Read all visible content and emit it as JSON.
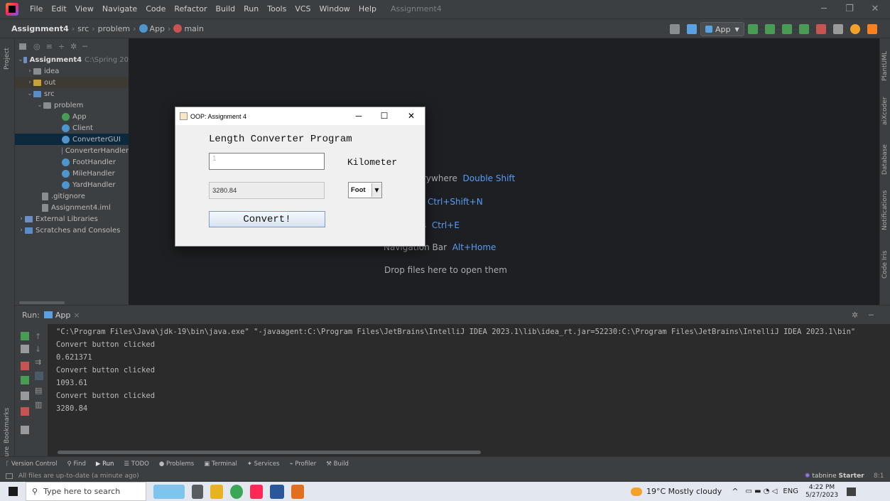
{
  "menubar": {
    "items": [
      "File",
      "Edit",
      "View",
      "Navigate",
      "Code",
      "Refactor",
      "Build",
      "Run",
      "Tools",
      "VCS",
      "Window",
      "Help"
    ],
    "project_title": "Assignment4"
  },
  "breadcrumb": {
    "project": "Assignment4",
    "items": [
      "src",
      "problem",
      "App",
      "main"
    ]
  },
  "toolbar": {
    "run_config": "App"
  },
  "left_strip": {
    "project": "Project",
    "bookmarks": "Bookmarks",
    "structure": "Structure"
  },
  "right_strip": {
    "items": [
      "PlantUML",
      "aiXcoder",
      "Database",
      "Notifications",
      "Code Iris"
    ]
  },
  "project_tree": {
    "root": "Assignment4",
    "root_path": "C:\\Spring 20",
    "items": [
      "idea",
      "out",
      "src",
      "problem",
      "App",
      "Client",
      "ConverterGUI",
      "ConverterHandler",
      "FootHandler",
      "MileHandler",
      "YardHandler",
      ".gitignore",
      "Assignment4.iml",
      "External Libraries",
      "Scratches and Consoles"
    ]
  },
  "editor_hints": {
    "search_everywhere": "rywhere",
    "search_everywhere_key": "Double Shift",
    "goto_file_key": "Ctrl+Shift+N",
    "recent_files": "s",
    "recent_files_key": "Ctrl+E",
    "nav_bar": "Navigation Bar",
    "nav_bar_key": "Alt+Home",
    "drop": "Drop files here to open them"
  },
  "dialog": {
    "title": "OOP: Assignment 4",
    "heading": "Length Converter Program",
    "input_value": "1",
    "input_unit": "Kilometer",
    "output_value": "3280.84",
    "selected_unit": "Foot",
    "convert_label": "Convert!"
  },
  "run_panel": {
    "label": "Run:",
    "tab": "App",
    "lines": [
      "\"C:\\Program Files\\Java\\jdk-19\\bin\\java.exe\" \"-javaagent:C:\\Program Files\\JetBrains\\IntelliJ IDEA 2023.1\\lib\\idea_rt.jar=52230:C:\\Program Files\\JetBrains\\IntelliJ IDEA 2023.1\\bin\"",
      "Convert button clicked",
      "0.621371",
      "Convert button clicked",
      "1093.61",
      "Convert button clicked",
      "3280.84"
    ]
  },
  "tool_tabs": [
    "Version Control",
    "Find",
    "Run",
    "TODO",
    "Problems",
    "Terminal",
    "Services",
    "Profiler",
    "Build"
  ],
  "status": {
    "message": "All files are up-to-date (a minute ago)",
    "plugin_name": "tabnine",
    "plugin_tier": "Starter",
    "position": "8:1"
  },
  "taskbar": {
    "search_placeholder": "Type here to search",
    "weather": "19°C  Mostly cloudy",
    "language": "ENG",
    "time": "4:22 PM",
    "date": "5/27/2023"
  },
  "colors": {
    "accent": "#589df6",
    "selection": "#0d293e",
    "editor_bg": "#1e1f22"
  }
}
